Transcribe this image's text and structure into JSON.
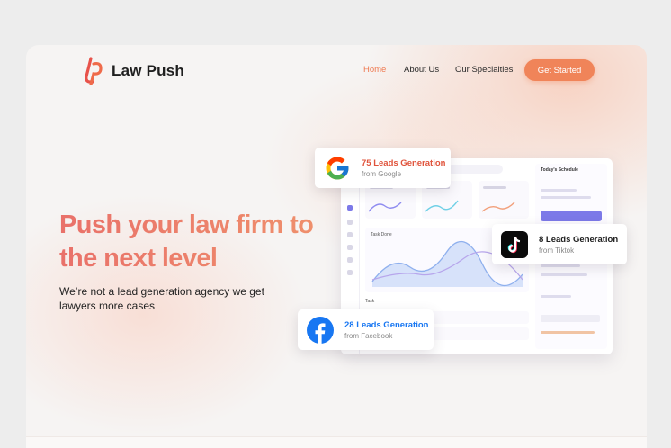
{
  "brand": {
    "name": "Law Push",
    "accent": "#f08459"
  },
  "nav": {
    "home": "Home",
    "about": "About Us",
    "specialties": "Our Specialties",
    "cta": "Get Started"
  },
  "hero": {
    "headline": "Push your law firm to the next level",
    "subline": "We’re not a lead generation agency we get lawyers more cases"
  },
  "cards": [
    {
      "title": "75 Leads Generation",
      "source": "from Google",
      "title_color": "#e0533b",
      "icon": "google-icon"
    },
    {
      "title": "8 Leads Generation",
      "source": "from Tiktok",
      "title_color": "#1e1e1e",
      "icon": "tiktok-icon"
    },
    {
      "title": "28 Leads Generation",
      "source": "from Facebook",
      "title_color": "#1877f2",
      "icon": "facebook-icon"
    }
  ],
  "dashboard": {
    "chart_label": "Task Done",
    "schedule_label": "Today's Schedule",
    "tasks_label": "Task"
  }
}
